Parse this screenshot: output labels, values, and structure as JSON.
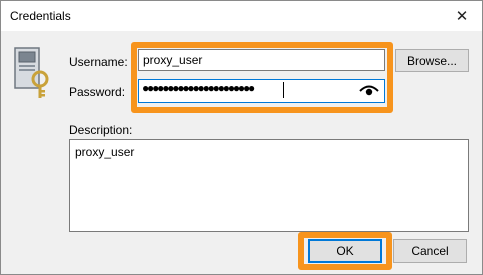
{
  "window": {
    "title": "Credentials",
    "close_glyph": "✕"
  },
  "form": {
    "username_label": "Username:",
    "username_value": "proxy_user",
    "password_label": "Password:",
    "password_masked": "●●●●●●●●●●●●●●●●●●●●●●",
    "description_label": "Description:",
    "description_value": "proxy_user"
  },
  "buttons": {
    "browse": "Browse...",
    "ok": "OK",
    "cancel": "Cancel"
  },
  "colors": {
    "highlight": "#f7941d",
    "focus": "#0078d7"
  },
  "icons": {
    "credentials": "computer-key-icon",
    "password_toggle": "eye-icon"
  }
}
